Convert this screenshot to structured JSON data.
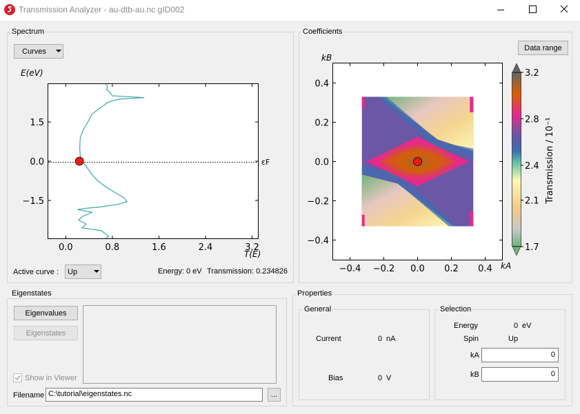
{
  "window": {
    "title": "Transmission Analyzer - au-dtb-au.nc gID002",
    "minimize_icon": "minimize-icon",
    "maximize_icon": "maximize-icon",
    "close_icon": "close-icon"
  },
  "spectrum": {
    "group_title": "Spectrum",
    "mode_select": "Curves",
    "active_curve_label": "Active curve :",
    "active_curve_value": "Up",
    "energy_readout": "Energy: 0 eV",
    "transmission_readout": "Transmission: 0.234826"
  },
  "coefficients": {
    "group_title": "Coefficients",
    "data_range_button": "Data range"
  },
  "eigenstates": {
    "group_title": "Eigenstates",
    "eigenvalues_button": "Eigenvalues",
    "eigenstates_button": "Eigenstates",
    "show_in_viewer_label": "Show in Viewer",
    "show_in_viewer_checked": true,
    "filename_label": "Filename",
    "filename_value": "C:\\tutorial\\eigenstates.nc",
    "browse_button": "..."
  },
  "properties": {
    "group_title": "Properties",
    "general": {
      "title": "General",
      "current_label": "Current",
      "current_value": "0",
      "current_unit": "nA",
      "bias_label": "Bias",
      "bias_value": "0",
      "bias_unit": "V"
    },
    "selection": {
      "title": "Selection",
      "energy_label": "Energy",
      "energy_value": "0",
      "energy_unit": "eV",
      "spin_label": "Spin",
      "spin_value": "Up",
      "ka_label": "kA",
      "ka_value": "0",
      "kb_label": "kB",
      "kb_value": "0"
    }
  },
  "chart_data": [
    {
      "type": "line",
      "ylabel": "E(eV)",
      "xlabel": "T(E)",
      "fermi_label": "εF",
      "xlim": [
        -0.3,
        3.3
      ],
      "ylim": [
        -2.95,
        2.95
      ],
      "xticks": [
        "0.0",
        "0.8",
        "1.6",
        "2.4",
        "3.2"
      ],
      "yticks": [
        "1.5",
        "0.0",
        "−1.5"
      ],
      "line_color": "#3aa9a4",
      "marker_color": "#ee1c12",
      "marker": {
        "x": 0.235,
        "y": 0.0
      },
      "series": [
        {
          "x": [
            0.68,
            0.72,
            0.7,
            0.75,
            0.8,
            1.35,
            0.9,
            0.72,
            0.6,
            0.45,
            0.38,
            0.3,
            0.25,
            0.24,
            0.25,
            0.28,
            0.35,
            0.45,
            0.55,
            0.7,
            0.85,
            1.0,
            1.05,
            0.9,
            0.6,
            0.35,
            0.2,
            0.45,
            0.3,
            0.22,
            0.35,
            0.28,
            0.6,
            0.65,
            0.7,
            0.74,
            0.68
          ],
          "y": [
            2.95,
            2.85,
            2.75,
            2.65,
            2.5,
            2.43,
            2.37,
            2.25,
            2.05,
            1.8,
            1.5,
            1.2,
            0.9,
            0.5,
            0.2,
            0.0,
            -0.2,
            -0.5,
            -0.75,
            -1.0,
            -1.2,
            -1.4,
            -1.55,
            -1.65,
            -1.75,
            -1.8,
            -1.85,
            -1.95,
            -2.1,
            -2.25,
            -2.4,
            -2.55,
            -2.65,
            -2.72,
            -2.8,
            -2.88,
            -2.95
          ]
        }
      ]
    },
    {
      "type": "heatmap",
      "xlabel": "kA",
      "ylabel": "kB",
      "colorbar_label": "Transmission / 10⁻¹",
      "xlim": [
        -0.5,
        0.5
      ],
      "ylim": [
        -0.5,
        0.5
      ],
      "xticks": [
        "−0.4",
        "−0.2",
        "0.0",
        "0.2",
        "0.4"
      ],
      "yticks": [
        "0.4",
        "0.2",
        "0.0",
        "−0.2",
        "−0.4"
      ],
      "data_extent": [
        -0.33,
        0.33
      ],
      "colorbar_ticks": [
        "3.2",
        "2.8",
        "2.4",
        "2.1",
        "1.7"
      ],
      "clim": [
        1.7,
        3.2
      ],
      "colormap": [
        "#6fb37a",
        "#c9c9c9",
        "#f2c98a",
        "#fdf9b7",
        "#66c2a5",
        "#3d6db0",
        "#6b57a6",
        "#e7298a",
        "#d95f02",
        "#666666"
      ],
      "marker": {
        "x": 0.0,
        "y": 0.0
      }
    }
  ]
}
